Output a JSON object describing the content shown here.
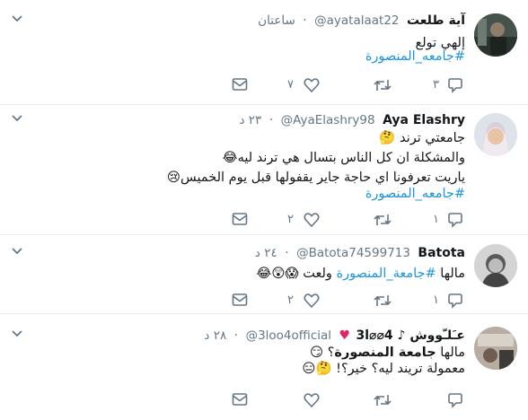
{
  "tweets": [
    {
      "name": "آية طلعت",
      "handle": "@ayatalaat22",
      "time": "ساعتان",
      "lines": [
        {
          "text": "إلهي تولع",
          "emoji": ""
        },
        {
          "text": "#جامعه_المنصورة",
          "emoji": ""
        }
      ],
      "reply_count": "٣",
      "retweet_count": "",
      "like_count": "٧"
    },
    {
      "name": "Aya Elashry",
      "handle": "@AyaElashry98",
      "time": "٢٣ د",
      "lines": [
        {
          "text": "جامعتي ترند",
          "emoji": "🤔"
        },
        {
          "text": "والمشكلة ان كل الناس بتسال هي ترند ليه",
          "emoji": "😂"
        },
        {
          "text": "ياريت تعرفونا اي حاجة جاير يقفولها قبل يوم الخميس",
          "emoji": "😢"
        },
        {
          "text": "#جامعه_المنصورة",
          "emoji": ""
        }
      ],
      "reply_count": "١",
      "retweet_count": "",
      "like_count": "٢"
    },
    {
      "name": "Batota",
      "handle": "@Batota74599713",
      "time": "٢٤ د",
      "lines": [
        {
          "pre": "مالها ",
          "tag": "#جامعة_المنصورة",
          "post": " ولعت",
          "emoji": "😱😲😂"
        }
      ],
      "reply_count": "١",
      "retweet_count": "",
      "like_count": "٢"
    },
    {
      "name": "عـَلـّووش ♪ 3l⌀⌀4",
      "heart": "♥",
      "handle": "@3loo4official",
      "time": "٢٨ د",
      "lines": [
        {
          "pre": "مالها ",
          "tag": "جامعة المنصورة",
          "post": "؟",
          "emoji": "😏"
        },
        {
          "text": "معمولة تريند ليه؟ خير؟!",
          "emoji": "🤔😑"
        }
      ],
      "reply_count": "",
      "retweet_count": "",
      "like_count": ""
    }
  ],
  "colors": {
    "accent": "#1b95e0",
    "muted": "#657786",
    "divider": "#e6ecf0",
    "heart": "#e0245e"
  },
  "icons": [
    "caret-down-icon",
    "reply-icon",
    "retweet-icon",
    "like-icon",
    "dm-icon"
  ]
}
